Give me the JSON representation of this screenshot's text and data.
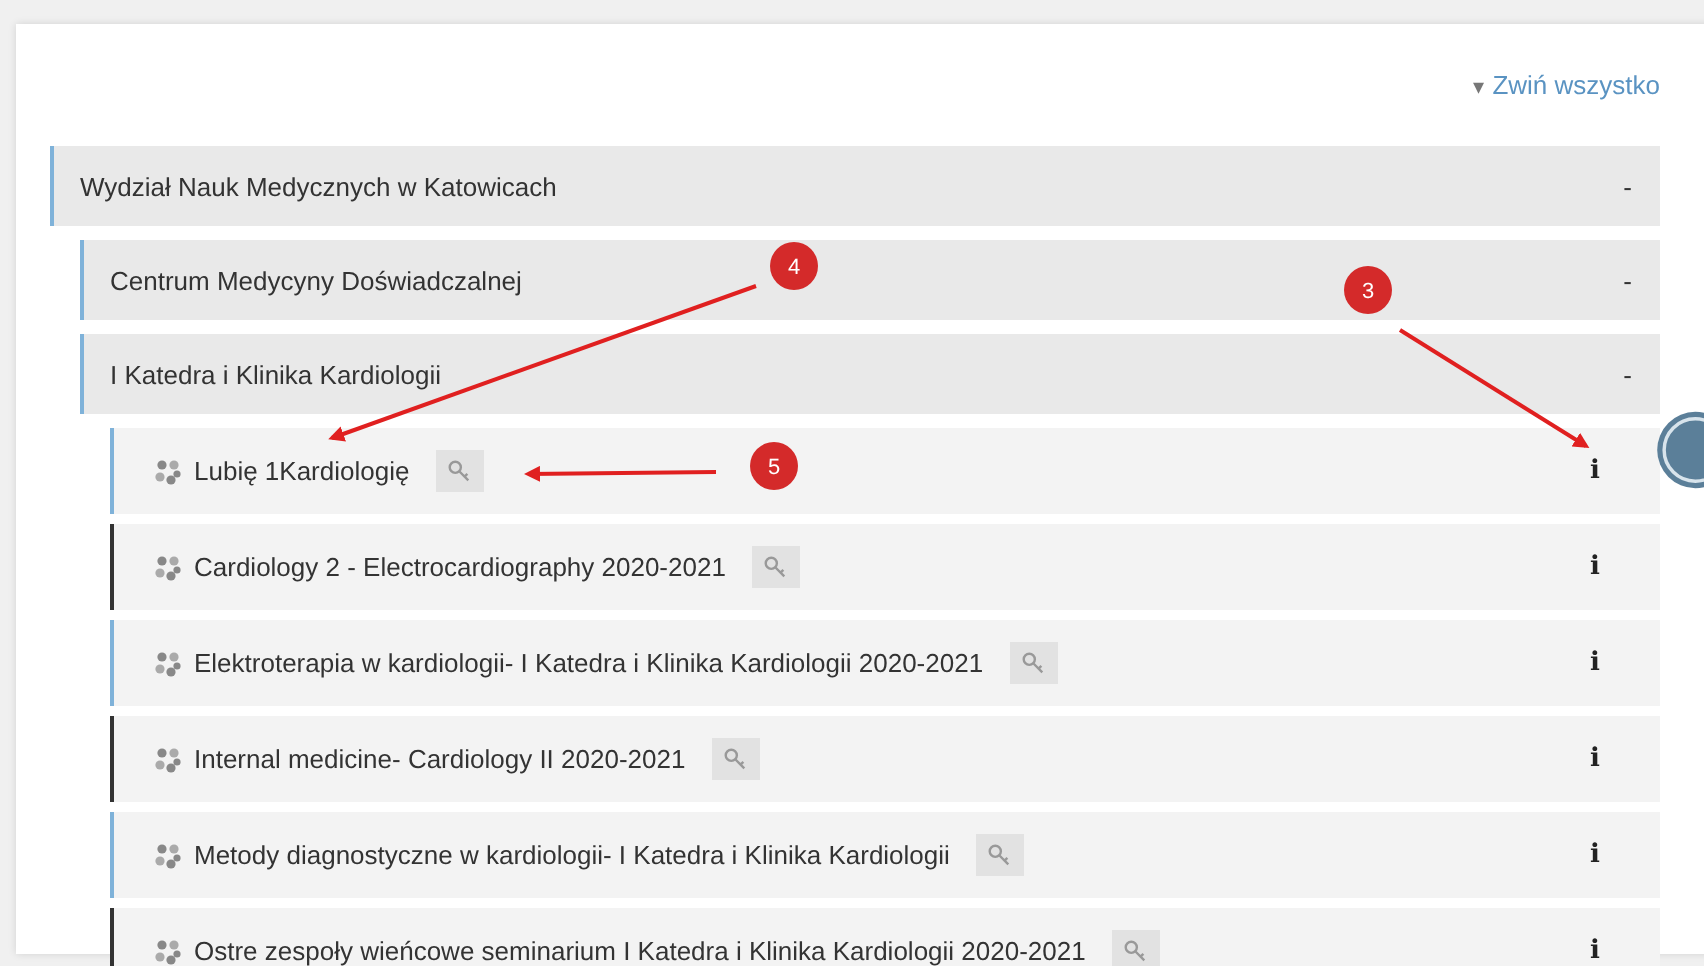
{
  "collapse_all": {
    "icon": "▾",
    "label": "Zwiń wszystko"
  },
  "categories": [
    {
      "name": "Wydział Nauk Medycznych w Katowicach",
      "toggle": "-",
      "children": [
        {
          "name": "Centrum Medycyny Doświadczalnej",
          "toggle": "-"
        },
        {
          "name": "I Katedra i Klinika Kardiologii",
          "toggle": "-",
          "courses": [
            {
              "name": "Lubię 1Kardiologię",
              "color": "#7fb2d9",
              "info": "i"
            },
            {
              "name": "Cardiology 2 - Electrocardiography 2020-2021",
              "color": "#333333",
              "info": "i"
            },
            {
              "name": "Elektroterapia w kardiologii- I Katedra i Klinika Kardiologii 2020-2021",
              "color": "#7fb2d9",
              "info": "i"
            },
            {
              "name": "Internal medicine- Cardiology II 2020-2021",
              "color": "#333333",
              "info": "i"
            },
            {
              "name": "Metody diagnostyczne w kardiologii- I Katedra i Klinika Kardiologii",
              "color": "#7fb2d9",
              "info": "i"
            },
            {
              "name": "Ostre zespoły wieńcowe seminarium I Katedra i Klinika Kardiologii 2020-2021",
              "color": "#333333",
              "info": "i"
            }
          ]
        }
      ]
    }
  ],
  "annotations": [
    {
      "label": "4"
    },
    {
      "label": "3"
    },
    {
      "label": "5"
    }
  ]
}
